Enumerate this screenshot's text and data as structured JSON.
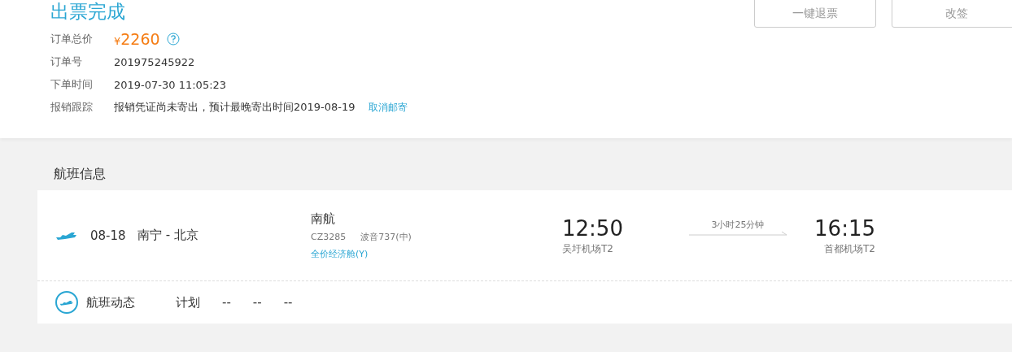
{
  "order": {
    "status": "出票完成",
    "buttons": [
      "一键退票",
      "改签"
    ],
    "fields": [
      {
        "kind": "price",
        "label": "订单总价",
        "currency": "¥",
        "value": "2260"
      },
      {
        "kind": "text",
        "label": "订单号",
        "value": "201975245922"
      },
      {
        "kind": "text",
        "label": "下单时间",
        "value": "2019-07-30 11:05:23"
      },
      {
        "kind": "link",
        "label": "报销跟踪",
        "value": "报销凭证尚未寄出，预计最晚寄出时间2019-08-19",
        "link": "取消邮寄"
      }
    ]
  },
  "flight_info": {
    "heading": "航班信息",
    "date": "08-18",
    "route": "南宁 - 北京",
    "airline": "南航",
    "flight_no": "CZ3285",
    "aircraft": "波音737(中)",
    "cabin": "全价经济舱(Y)",
    "departure": {
      "time": "12:50",
      "airport": "吴圩机场T2"
    },
    "duration": "3小时25分钟",
    "arrival": {
      "time": "16:15",
      "airport": "首都机场T2"
    },
    "status": {
      "label": "航班动态",
      "plan_label": "计划",
      "values": [
        "--",
        "--",
        "--"
      ]
    }
  }
}
